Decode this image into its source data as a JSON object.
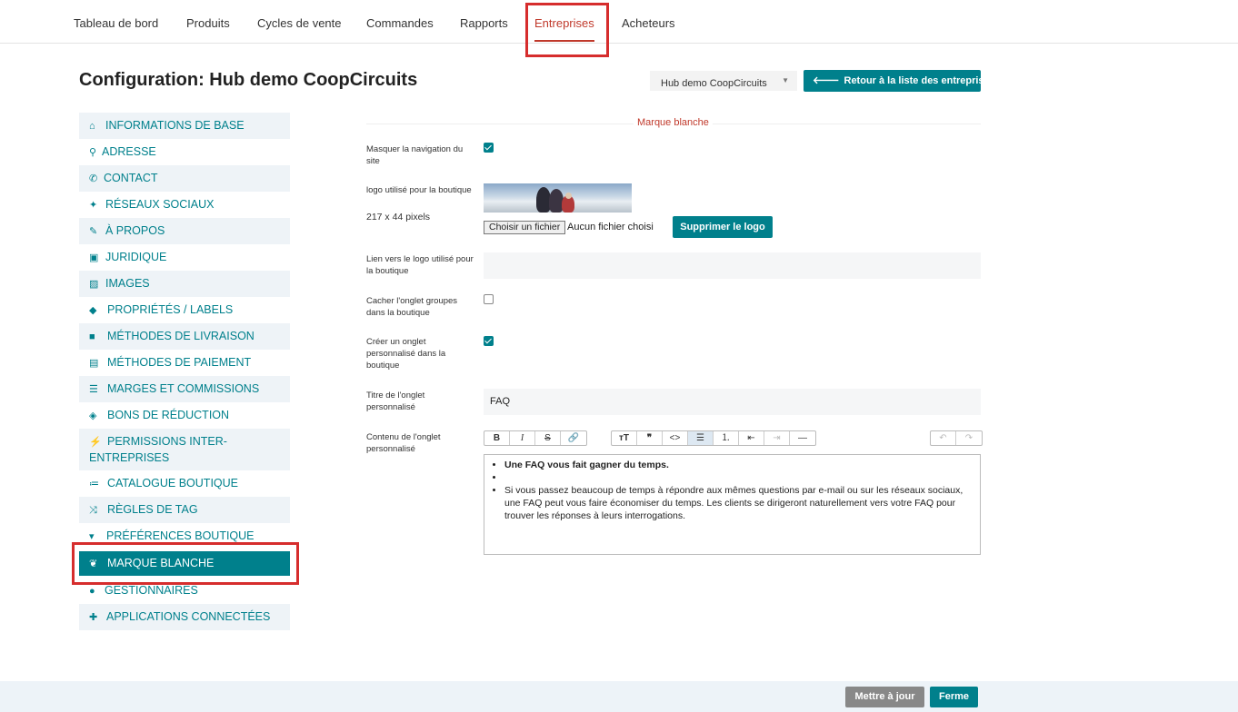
{
  "nav": {
    "items": [
      {
        "label": "Tableau de bord",
        "active": false
      },
      {
        "label": "Produits",
        "active": false
      },
      {
        "label": "Cycles de vente",
        "active": false
      },
      {
        "label": "Commandes",
        "active": false
      },
      {
        "label": "Rapports",
        "active": false
      },
      {
        "label": "Entreprises",
        "active": true
      },
      {
        "label": "Acheteurs",
        "active": false
      }
    ]
  },
  "header": {
    "title": "Configuration: Hub demo CoopCircuits",
    "enterprise_select": "Hub demo CoopCircuits",
    "back_button": "Retour à la liste des entreprises"
  },
  "sidebar": {
    "items": [
      {
        "label": "INFORMATIONS DE BASE",
        "icon": "home-icon"
      },
      {
        "label": "ADRESSE",
        "icon": "map-marker-icon"
      },
      {
        "label": "CONTACT",
        "icon": "phone-icon"
      },
      {
        "label": "RÉSEAUX SOCIAUX",
        "icon": "twitter-icon"
      },
      {
        "label": "À PROPOS",
        "icon": "pencil-icon"
      },
      {
        "label": "JURIDIQUE",
        "icon": "briefcase-icon"
      },
      {
        "label": "IMAGES",
        "icon": "image-icon"
      },
      {
        "label": "PROPRIÉTÉS / LABELS",
        "icon": "tags-icon"
      },
      {
        "label": "MÉTHODES DE LIVRAISON",
        "icon": "truck-icon"
      },
      {
        "label": "MÉTHODES DE PAIEMENT",
        "icon": "money-icon"
      },
      {
        "label": "MARGES ET COMMISSIONS",
        "icon": "list-icon"
      },
      {
        "label": "BONS DE RÉDUCTION",
        "icon": "tag-icon"
      },
      {
        "label": "PERMISSIONS INTER-ENTREPRISES",
        "icon": "plug-icon"
      },
      {
        "label": "CATALOGUE BOUTIQUE",
        "icon": "list-ul-icon"
      },
      {
        "label": "RÈGLES DE TAG",
        "icon": "random-icon"
      },
      {
        "label": "PRÉFÉRENCES BOUTIQUE",
        "icon": "cart-icon"
      },
      {
        "label": "MARQUE BLANCHE",
        "icon": "leaf-icon",
        "active": true
      },
      {
        "label": "GESTIONNAIRES",
        "icon": "user-icon"
      },
      {
        "label": "APPLICATIONS CONNECTÉES",
        "icon": "puzzle-icon"
      }
    ]
  },
  "form": {
    "section_title": "Marque blanche",
    "hide_nav_label": "Masquer la navigation du site",
    "hide_nav_checked": true,
    "logo_label": "logo utilisé pour la boutique",
    "logo_size": "217 x 44 pixels",
    "file_button": "Choisir un fichier",
    "file_none": "Aucun fichier choisi",
    "delete_logo_button": "Supprimer le logo",
    "logo_link_label": "Lien vers le logo utilisé pour la boutique",
    "logo_link_value": "",
    "hide_groups_label": "Cacher l'onglet groupes dans la boutique",
    "hide_groups_checked": false,
    "custom_tab_label": "Créer un onglet personnalisé dans la boutique",
    "custom_tab_checked": true,
    "tab_title_label": "Titre de l'onglet personnalisé",
    "tab_title_value": "FAQ",
    "tab_content_label": "Contenu de l'onglet personnalisé",
    "editor_lines": [
      "Une FAQ vous fait gagner du temps.",
      "",
      "Si vous passez beaucoup de temps à répondre aux mêmes questions par e-mail ou sur les réseaux sociaux, une FAQ peut vous faire économiser du temps. Les clients se dirigeront naturellement vers votre FAQ pour trouver les réponses à leurs interrogations."
    ]
  },
  "footer": {
    "update_button": "Mettre à jour",
    "close_button": "Ferme"
  },
  "colors": {
    "primary": "#00808c",
    "active_nav": "#c0392b",
    "highlight_box": "#d62d2d"
  }
}
